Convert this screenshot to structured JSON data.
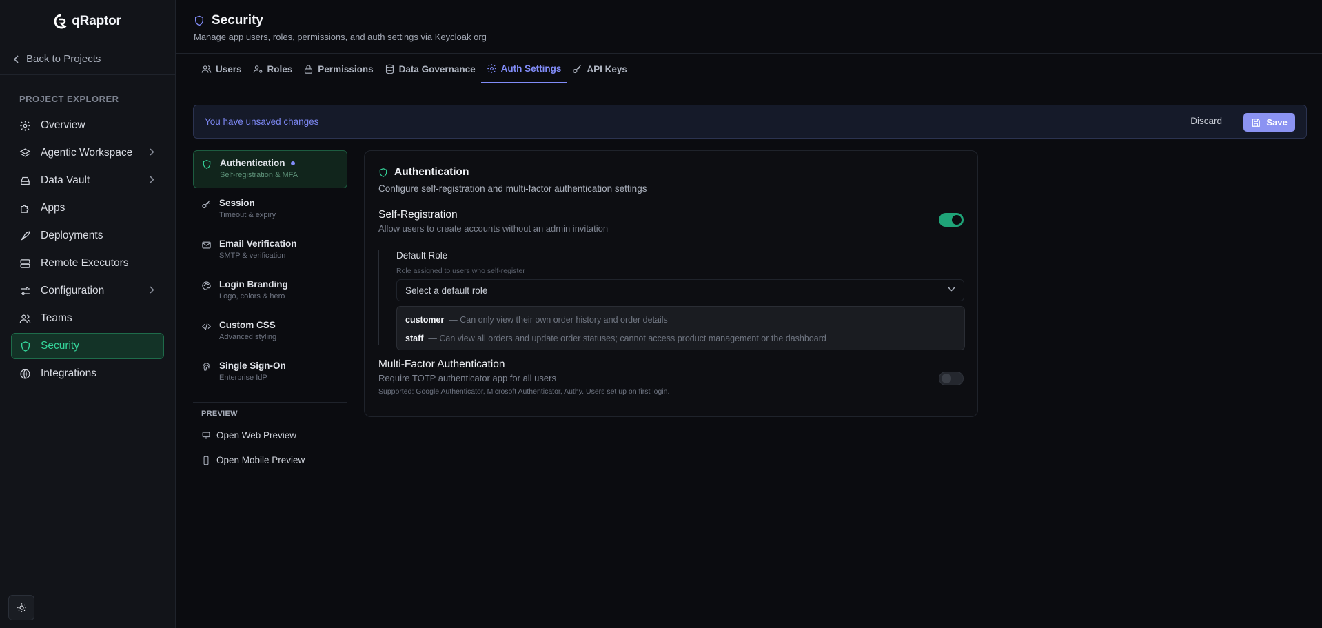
{
  "sidebar": {
    "brand": "qRaptor",
    "back_label": "Back to Projects",
    "section_label": "PROJECT EXPLORER",
    "items": [
      {
        "label": "Overview",
        "icon": "gear-icon"
      },
      {
        "label": "Agentic Workspace",
        "icon": "layers-icon",
        "has_chevron": true
      },
      {
        "label": "Data Vault",
        "icon": "drive-icon",
        "has_chevron": true
      },
      {
        "label": "Apps",
        "icon": "puzzle-icon"
      },
      {
        "label": "Deployments",
        "icon": "rocket-icon"
      },
      {
        "label": "Remote Executors",
        "icon": "server-icon"
      },
      {
        "label": "Configuration",
        "icon": "sliders-icon",
        "has_chevron": true
      },
      {
        "label": "Teams",
        "icon": "users-icon"
      },
      {
        "label": "Security",
        "icon": "shield-icon",
        "active": true
      },
      {
        "label": "Integrations",
        "icon": "globe-icon"
      }
    ],
    "theme_icon": "sun-icon"
  },
  "header": {
    "title": "Security",
    "subtitle": "Manage app users, roles, permissions, and auth settings via Keycloak org"
  },
  "tabs": [
    {
      "label": "Users",
      "icon": "users-icon"
    },
    {
      "label": "Roles",
      "icon": "user-cog-icon"
    },
    {
      "label": "Permissions",
      "icon": "lock-icon"
    },
    {
      "label": "Data Governance",
      "icon": "database-icon"
    },
    {
      "label": "Auth Settings",
      "icon": "gear-icon",
      "active": true
    },
    {
      "label": "API Keys",
      "icon": "key-icon"
    }
  ],
  "banner": {
    "message": "You have unsaved changes",
    "discard_label": "Discard",
    "save_label": "Save"
  },
  "settings_menu": {
    "items": [
      {
        "title": "Authentication",
        "subtitle": "Self-registration & MFA",
        "icon": "shield-icon",
        "active": true,
        "modified": true
      },
      {
        "title": "Session",
        "subtitle": "Timeout & expiry",
        "icon": "key-icon"
      },
      {
        "title": "Email Verification",
        "subtitle": "SMTP & verification",
        "icon": "mail-icon"
      },
      {
        "title": "Login Branding",
        "subtitle": "Logo, colors & hero",
        "icon": "palette-icon"
      },
      {
        "title": "Custom CSS",
        "subtitle": "Advanced styling",
        "icon": "code-icon"
      },
      {
        "title": "Single Sign-On",
        "subtitle": "Enterprise IdP",
        "icon": "fingerprint-icon"
      }
    ],
    "preview_label": "PREVIEW",
    "web_preview_label": "Open Web Preview",
    "mobile_preview_label": "Open Mobile Preview"
  },
  "auth": {
    "title": "Authentication",
    "description": "Configure self-registration and multi-factor authentication settings",
    "self_registration": {
      "title": "Self-Registration",
      "description": "Allow users to create accounts without an admin invitation",
      "enabled": true
    },
    "default_role": {
      "label": "Default Role",
      "hint": "Role assigned to users who self-register",
      "placeholder": "Select a default role",
      "options": [
        {
          "name": "customer",
          "description": "— Can only view their own order history and order details"
        },
        {
          "name": "staff",
          "description": "— Can view all orders and update order statuses; cannot access product management or the dashboard"
        }
      ]
    },
    "mfa": {
      "title": "Multi-Factor Authentication",
      "description": "Require TOTP authenticator app for all users",
      "note": "Supported: Google Authenticator, Microsoft Authenticator, Authy. Users set up on first login.",
      "enabled": false
    }
  },
  "colors": {
    "accent": "#818cf8",
    "success": "#34d399",
    "toggle_on": "#1fa478"
  }
}
